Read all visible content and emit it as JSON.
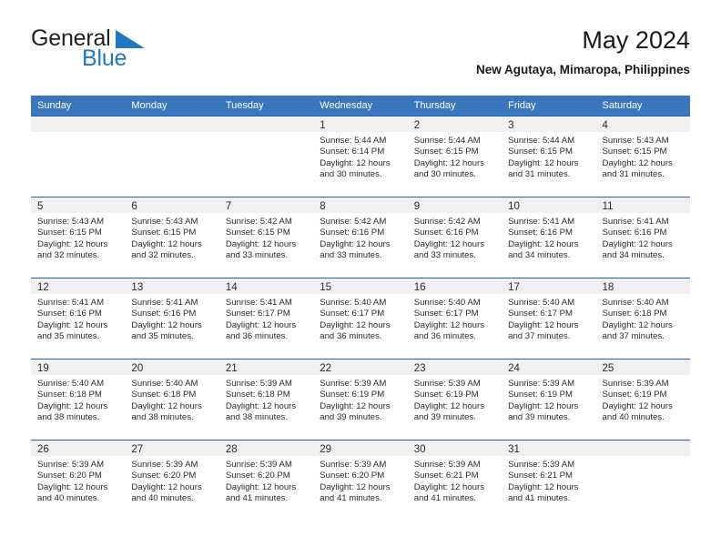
{
  "brand": {
    "name_part1": "General",
    "name_part2": "Blue",
    "accent_color": "#1f78c1"
  },
  "header": {
    "title": "May 2024",
    "subtitle": "New Agutaya, Mimaropa, Philippines",
    "header_bg_color": "#3a76bd",
    "week_border_color": "#1f64ad"
  },
  "weekdays": [
    "Sunday",
    "Monday",
    "Tuesday",
    "Wednesday",
    "Thursday",
    "Friday",
    "Saturday"
  ],
  "weeks": [
    [
      {
        "day": "",
        "sunrise": "",
        "sunset": "",
        "daylight1": "",
        "daylight2": ""
      },
      {
        "day": "",
        "sunrise": "",
        "sunset": "",
        "daylight1": "",
        "daylight2": ""
      },
      {
        "day": "",
        "sunrise": "",
        "sunset": "",
        "daylight1": "",
        "daylight2": ""
      },
      {
        "day": "1",
        "sunrise": "Sunrise: 5:44 AM",
        "sunset": "Sunset: 6:14 PM",
        "daylight1": "Daylight: 12 hours",
        "daylight2": "and 30 minutes."
      },
      {
        "day": "2",
        "sunrise": "Sunrise: 5:44 AM",
        "sunset": "Sunset: 6:15 PM",
        "daylight1": "Daylight: 12 hours",
        "daylight2": "and 30 minutes."
      },
      {
        "day": "3",
        "sunrise": "Sunrise: 5:44 AM",
        "sunset": "Sunset: 6:15 PM",
        "daylight1": "Daylight: 12 hours",
        "daylight2": "and 31 minutes."
      },
      {
        "day": "4",
        "sunrise": "Sunrise: 5:43 AM",
        "sunset": "Sunset: 6:15 PM",
        "daylight1": "Daylight: 12 hours",
        "daylight2": "and 31 minutes."
      }
    ],
    [
      {
        "day": "5",
        "sunrise": "Sunrise: 5:43 AM",
        "sunset": "Sunset: 6:15 PM",
        "daylight1": "Daylight: 12 hours",
        "daylight2": "and 32 minutes."
      },
      {
        "day": "6",
        "sunrise": "Sunrise: 5:43 AM",
        "sunset": "Sunset: 6:15 PM",
        "daylight1": "Daylight: 12 hours",
        "daylight2": "and 32 minutes."
      },
      {
        "day": "7",
        "sunrise": "Sunrise: 5:42 AM",
        "sunset": "Sunset: 6:15 PM",
        "daylight1": "Daylight: 12 hours",
        "daylight2": "and 33 minutes."
      },
      {
        "day": "8",
        "sunrise": "Sunrise: 5:42 AM",
        "sunset": "Sunset: 6:16 PM",
        "daylight1": "Daylight: 12 hours",
        "daylight2": "and 33 minutes."
      },
      {
        "day": "9",
        "sunrise": "Sunrise: 5:42 AM",
        "sunset": "Sunset: 6:16 PM",
        "daylight1": "Daylight: 12 hours",
        "daylight2": "and 33 minutes."
      },
      {
        "day": "10",
        "sunrise": "Sunrise: 5:41 AM",
        "sunset": "Sunset: 6:16 PM",
        "daylight1": "Daylight: 12 hours",
        "daylight2": "and 34 minutes."
      },
      {
        "day": "11",
        "sunrise": "Sunrise: 5:41 AM",
        "sunset": "Sunset: 6:16 PM",
        "daylight1": "Daylight: 12 hours",
        "daylight2": "and 34 minutes."
      }
    ],
    [
      {
        "day": "12",
        "sunrise": "Sunrise: 5:41 AM",
        "sunset": "Sunset: 6:16 PM",
        "daylight1": "Daylight: 12 hours",
        "daylight2": "and 35 minutes."
      },
      {
        "day": "13",
        "sunrise": "Sunrise: 5:41 AM",
        "sunset": "Sunset: 6:16 PM",
        "daylight1": "Daylight: 12 hours",
        "daylight2": "and 35 minutes."
      },
      {
        "day": "14",
        "sunrise": "Sunrise: 5:41 AM",
        "sunset": "Sunset: 6:17 PM",
        "daylight1": "Daylight: 12 hours",
        "daylight2": "and 36 minutes."
      },
      {
        "day": "15",
        "sunrise": "Sunrise: 5:40 AM",
        "sunset": "Sunset: 6:17 PM",
        "daylight1": "Daylight: 12 hours",
        "daylight2": "and 36 minutes."
      },
      {
        "day": "16",
        "sunrise": "Sunrise: 5:40 AM",
        "sunset": "Sunset: 6:17 PM",
        "daylight1": "Daylight: 12 hours",
        "daylight2": "and 36 minutes."
      },
      {
        "day": "17",
        "sunrise": "Sunrise: 5:40 AM",
        "sunset": "Sunset: 6:17 PM",
        "daylight1": "Daylight: 12 hours",
        "daylight2": "and 37 minutes."
      },
      {
        "day": "18",
        "sunrise": "Sunrise: 5:40 AM",
        "sunset": "Sunset: 6:18 PM",
        "daylight1": "Daylight: 12 hours",
        "daylight2": "and 37 minutes."
      }
    ],
    [
      {
        "day": "19",
        "sunrise": "Sunrise: 5:40 AM",
        "sunset": "Sunset: 6:18 PM",
        "daylight1": "Daylight: 12 hours",
        "daylight2": "and 38 minutes."
      },
      {
        "day": "20",
        "sunrise": "Sunrise: 5:40 AM",
        "sunset": "Sunset: 6:18 PM",
        "daylight1": "Daylight: 12 hours",
        "daylight2": "and 38 minutes."
      },
      {
        "day": "21",
        "sunrise": "Sunrise: 5:39 AM",
        "sunset": "Sunset: 6:18 PM",
        "daylight1": "Daylight: 12 hours",
        "daylight2": "and 38 minutes."
      },
      {
        "day": "22",
        "sunrise": "Sunrise: 5:39 AM",
        "sunset": "Sunset: 6:19 PM",
        "daylight1": "Daylight: 12 hours",
        "daylight2": "and 39 minutes."
      },
      {
        "day": "23",
        "sunrise": "Sunrise: 5:39 AM",
        "sunset": "Sunset: 6:19 PM",
        "daylight1": "Daylight: 12 hours",
        "daylight2": "and 39 minutes."
      },
      {
        "day": "24",
        "sunrise": "Sunrise: 5:39 AM",
        "sunset": "Sunset: 6:19 PM",
        "daylight1": "Daylight: 12 hours",
        "daylight2": "and 39 minutes."
      },
      {
        "day": "25",
        "sunrise": "Sunrise: 5:39 AM",
        "sunset": "Sunset: 6:19 PM",
        "daylight1": "Daylight: 12 hours",
        "daylight2": "and 40 minutes."
      }
    ],
    [
      {
        "day": "26",
        "sunrise": "Sunrise: 5:39 AM",
        "sunset": "Sunset: 6:20 PM",
        "daylight1": "Daylight: 12 hours",
        "daylight2": "and 40 minutes."
      },
      {
        "day": "27",
        "sunrise": "Sunrise: 5:39 AM",
        "sunset": "Sunset: 6:20 PM",
        "daylight1": "Daylight: 12 hours",
        "daylight2": "and 40 minutes."
      },
      {
        "day": "28",
        "sunrise": "Sunrise: 5:39 AM",
        "sunset": "Sunset: 6:20 PM",
        "daylight1": "Daylight: 12 hours",
        "daylight2": "and 41 minutes."
      },
      {
        "day": "29",
        "sunrise": "Sunrise: 5:39 AM",
        "sunset": "Sunset: 6:20 PM",
        "daylight1": "Daylight: 12 hours",
        "daylight2": "and 41 minutes."
      },
      {
        "day": "30",
        "sunrise": "Sunrise: 5:39 AM",
        "sunset": "Sunset: 6:21 PM",
        "daylight1": "Daylight: 12 hours",
        "daylight2": "and 41 minutes."
      },
      {
        "day": "31",
        "sunrise": "Sunrise: 5:39 AM",
        "sunset": "Sunset: 6:21 PM",
        "daylight1": "Daylight: 12 hours",
        "daylight2": "and 41 minutes."
      },
      {
        "day": "",
        "sunrise": "",
        "sunset": "",
        "daylight1": "",
        "daylight2": ""
      }
    ]
  ]
}
